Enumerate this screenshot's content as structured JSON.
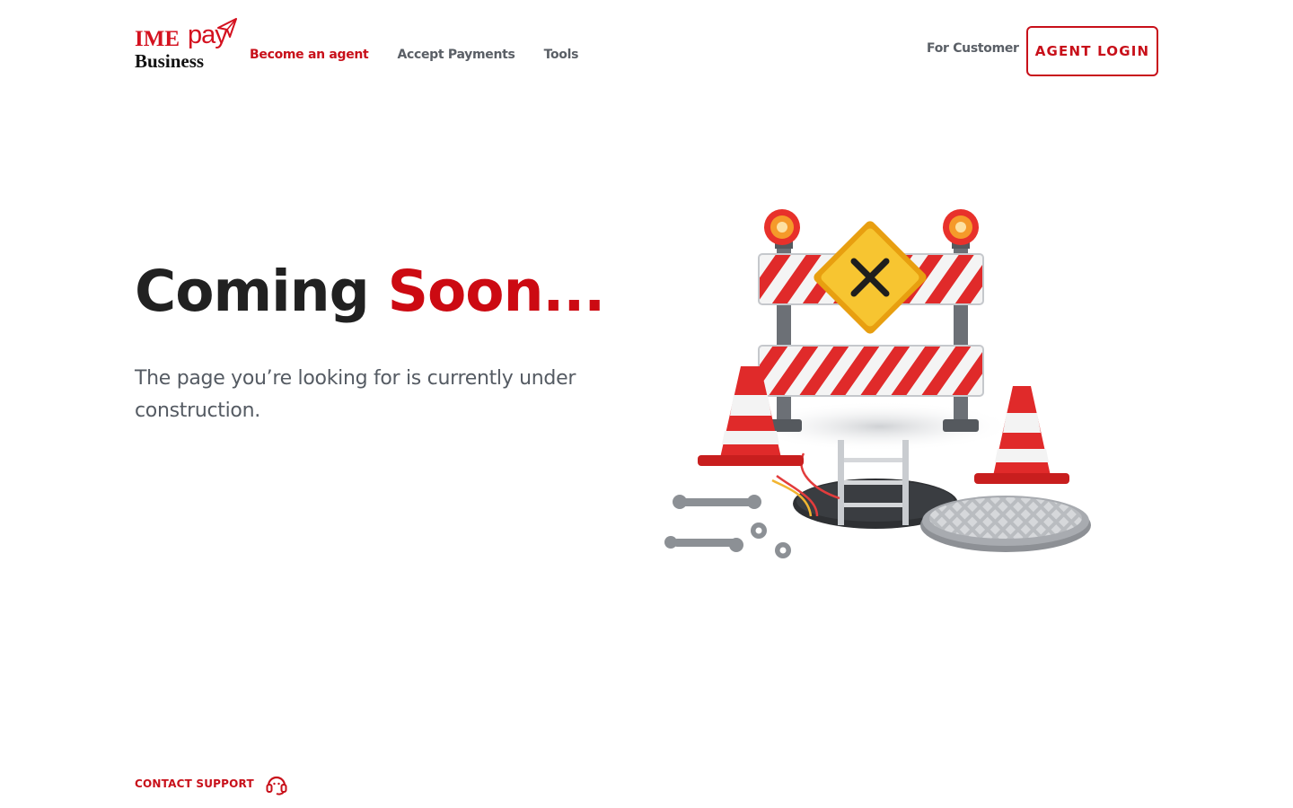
{
  "header": {
    "logo": {
      "brand_prefix": "IME",
      "brand_suffix": "pay",
      "subtitle": "Business"
    },
    "nav": [
      {
        "label": "Become an agent",
        "active": true
      },
      {
        "label": "Accept Payments",
        "active": false
      },
      {
        "label": "Tools",
        "active": false
      }
    ],
    "for_customer": "For Customer",
    "agent_login": "AGENT LOGIN"
  },
  "hero": {
    "title_main": "Coming ",
    "title_accent": "Soon...",
    "subtitle": "The page you’re looking for is currently under construction."
  },
  "footer": {
    "contact_support": "CONTACT SUPPORT"
  },
  "colors": {
    "brand_red": "#c8101a",
    "text_dark": "#212121",
    "text_gray": "#5a5f66"
  }
}
